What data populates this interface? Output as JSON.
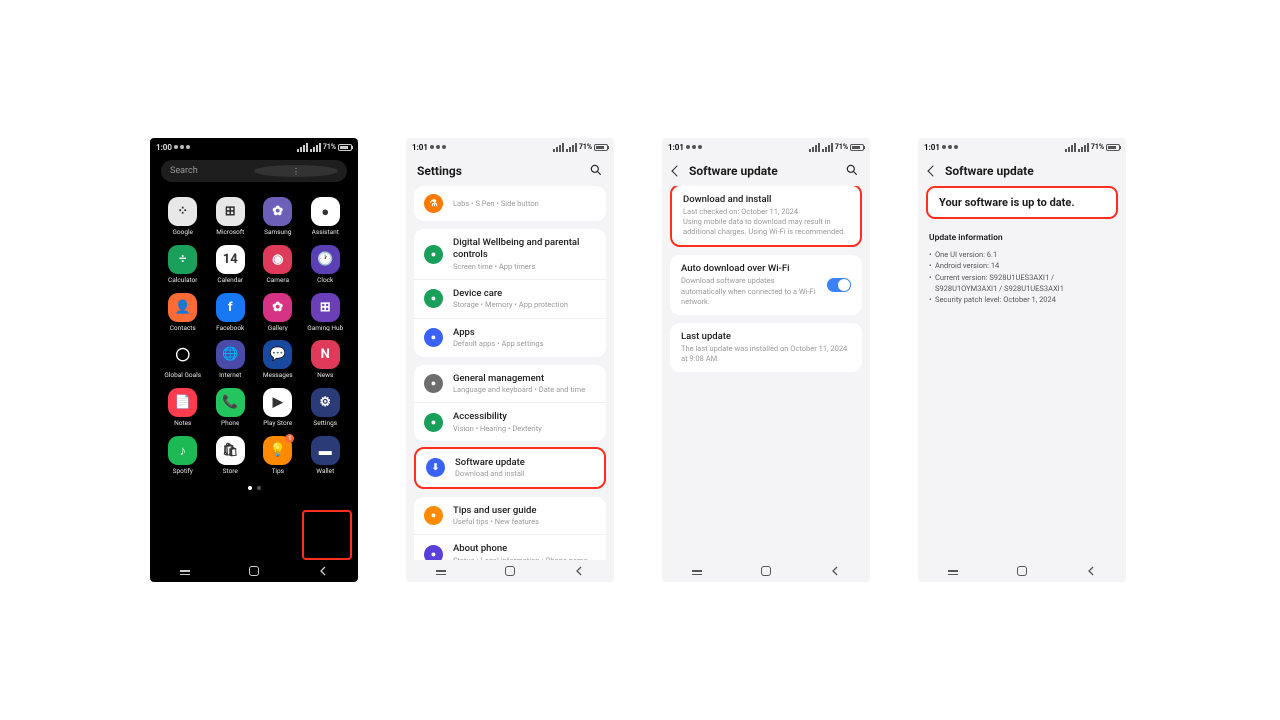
{
  "status": {
    "time1": "1:00",
    "time": "1:01",
    "battery": "71%"
  },
  "p1": {
    "search": "Search",
    "apps": [
      {
        "n": "Google",
        "c": "#e8e8e8"
      },
      {
        "n": "Microsoft",
        "c": "#e8e8e8"
      },
      {
        "n": "Samsung",
        "c": "#6b5fb8"
      },
      {
        "n": "Assistant",
        "c": "#ffffff"
      },
      {
        "n": "Calculator",
        "c": "#1aa05a"
      },
      {
        "n": "Calendar",
        "c": "#ffffff"
      },
      {
        "n": "Camera",
        "c": "#e03a5b"
      },
      {
        "n": "Clock",
        "c": "#5b3fb5"
      },
      {
        "n": "Contacts",
        "c": "#ff6b35"
      },
      {
        "n": "Facebook",
        "c": "#1877f2"
      },
      {
        "n": "Gallery",
        "c": "#d63384"
      },
      {
        "n": "Gaming Hub",
        "c": "#6b3fb8"
      },
      {
        "n": "Global Goals",
        "c": "#000000"
      },
      {
        "n": "Internet",
        "c": "#4a4aa8"
      },
      {
        "n": "Messages",
        "c": "#1a4aa0"
      },
      {
        "n": "News",
        "c": "#e03a5b"
      },
      {
        "n": "Notes",
        "c": "#ff3b4e"
      },
      {
        "n": "Phone",
        "c": "#22c55e"
      },
      {
        "n": "Play Store",
        "c": "#ffffff"
      },
      {
        "n": "Settings",
        "c": "#2a3b78"
      },
      {
        "n": "Spotify",
        "c": "#1db954"
      },
      {
        "n": "Store",
        "c": "#ffffff"
      },
      {
        "n": "Tips",
        "c": "#ff8a00"
      },
      {
        "n": "Wallet",
        "c": "#2a3b78"
      }
    ]
  },
  "p2": {
    "title": "Settings",
    "rows": [
      {
        "ttl": "",
        "sub": "Labs • S Pen • Side button",
        "c": "#ff7a00"
      },
      {
        "ttl": "Digital Wellbeing and parental controls",
        "sub": "Screen time • App timers",
        "c": "#18a05a"
      },
      {
        "ttl": "Device care",
        "sub": "Storage • Memory • App protection",
        "c": "#18a05a"
      },
      {
        "ttl": "Apps",
        "sub": "Default apps • App settings",
        "c": "#3b62f6"
      },
      {
        "ttl": "General management",
        "sub": "Language and keyboard • Date and time",
        "c": "#6d6d6d"
      },
      {
        "ttl": "Accessibility",
        "sub": "Vision • Hearing • Dexterity",
        "c": "#18a05a"
      },
      {
        "ttl": "Software update",
        "sub": "Download and install",
        "c": "#3b62f6",
        "hl": true
      },
      {
        "ttl": "Tips and user guide",
        "sub": "Useful tips • New features",
        "c": "#ff8a00"
      },
      {
        "ttl": "About phone",
        "sub": "Status • Legal information • Phone name",
        "c": "#5a3fd8"
      }
    ]
  },
  "p3": {
    "title": "Software update",
    "b1": {
      "ttl": "Download and install",
      "l1": "Last checked on: October 11, 2024",
      "l2": "Using mobile data to download may result in additional charges. Using Wi-Fi is recommended."
    },
    "b2": {
      "ttl": "Auto download over Wi-Fi",
      "body": "Download software updates automatically when connected to a Wi-Fi network."
    },
    "b3": {
      "ttl": "Last update",
      "body": "The last update was installed on October 11, 2024 at 9:08 AM."
    }
  },
  "p4": {
    "title": "Software update",
    "banner": "Your software is up to date.",
    "heading": "Update information",
    "items": [
      "One UI version: 6.1",
      "Android version: 14",
      "Current version: S928U1UES3AXI1 / S928U1OYM3AXI1 / S928U1UES3AXI1",
      "Security patch level: October 1, 2024"
    ]
  }
}
